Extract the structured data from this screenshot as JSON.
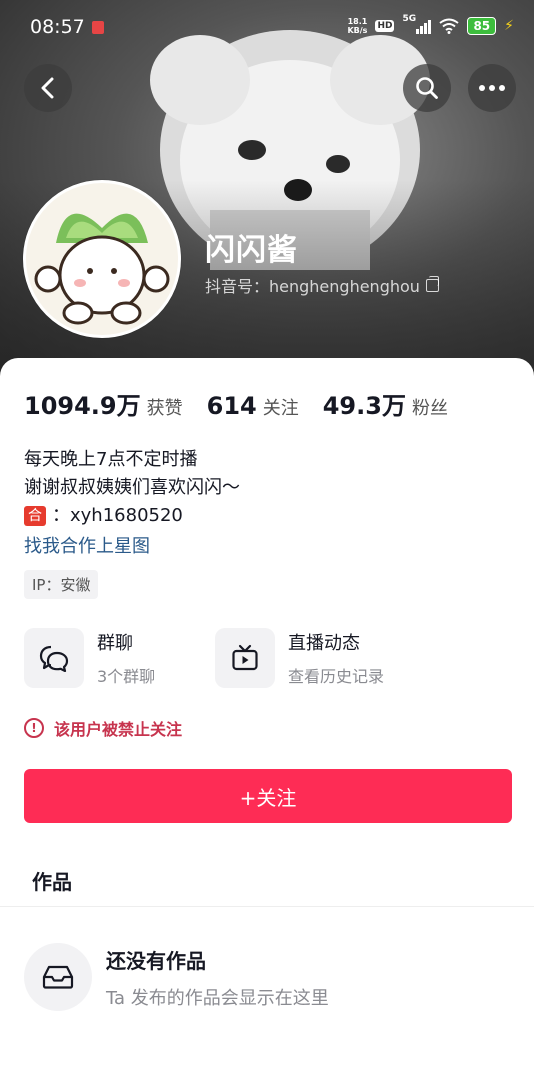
{
  "status_bar": {
    "time": "08:57",
    "net_speed_value": "18.1",
    "net_speed_unit": "KB/s",
    "hd": "HD",
    "network": "5G",
    "battery": "85"
  },
  "nav": {
    "back_icon": "chevron-left-icon",
    "search_icon": "search-icon",
    "more_icon": "more-horizontal-icon"
  },
  "profile": {
    "nickname": "闪闪酱",
    "douyin_id": "抖音号：henghenghenghou"
  },
  "stats": [
    {
      "value": "1094.9万",
      "label": "获赞"
    },
    {
      "value": "614",
      "label": "关注"
    },
    {
      "value": "49.3万",
      "label": "粉丝"
    }
  ],
  "bio": {
    "line1": "每天晚上7点不定时播",
    "line2": "谢谢叔叔姨姨们喜欢闪闪～",
    "badge": "合",
    "line3": "：xyh1680520",
    "link": "找我合作上星图",
    "ip": "IP：安徽"
  },
  "features": {
    "group_title": "群聊",
    "group_sub": "3个群聊",
    "live_title": "直播动态",
    "live_sub": "查看历史记录"
  },
  "notice": {
    "banned": "该用户被禁止关注"
  },
  "actions": {
    "follow": "+关注"
  },
  "works": {
    "tab": "作品",
    "empty_title": "还没有作品",
    "empty_sub": "Ta 发布的作品会显示在这里"
  },
  "colors": {
    "accent": "#fe2c55",
    "banned": "#c7344e",
    "link": "#2b5a8a"
  }
}
